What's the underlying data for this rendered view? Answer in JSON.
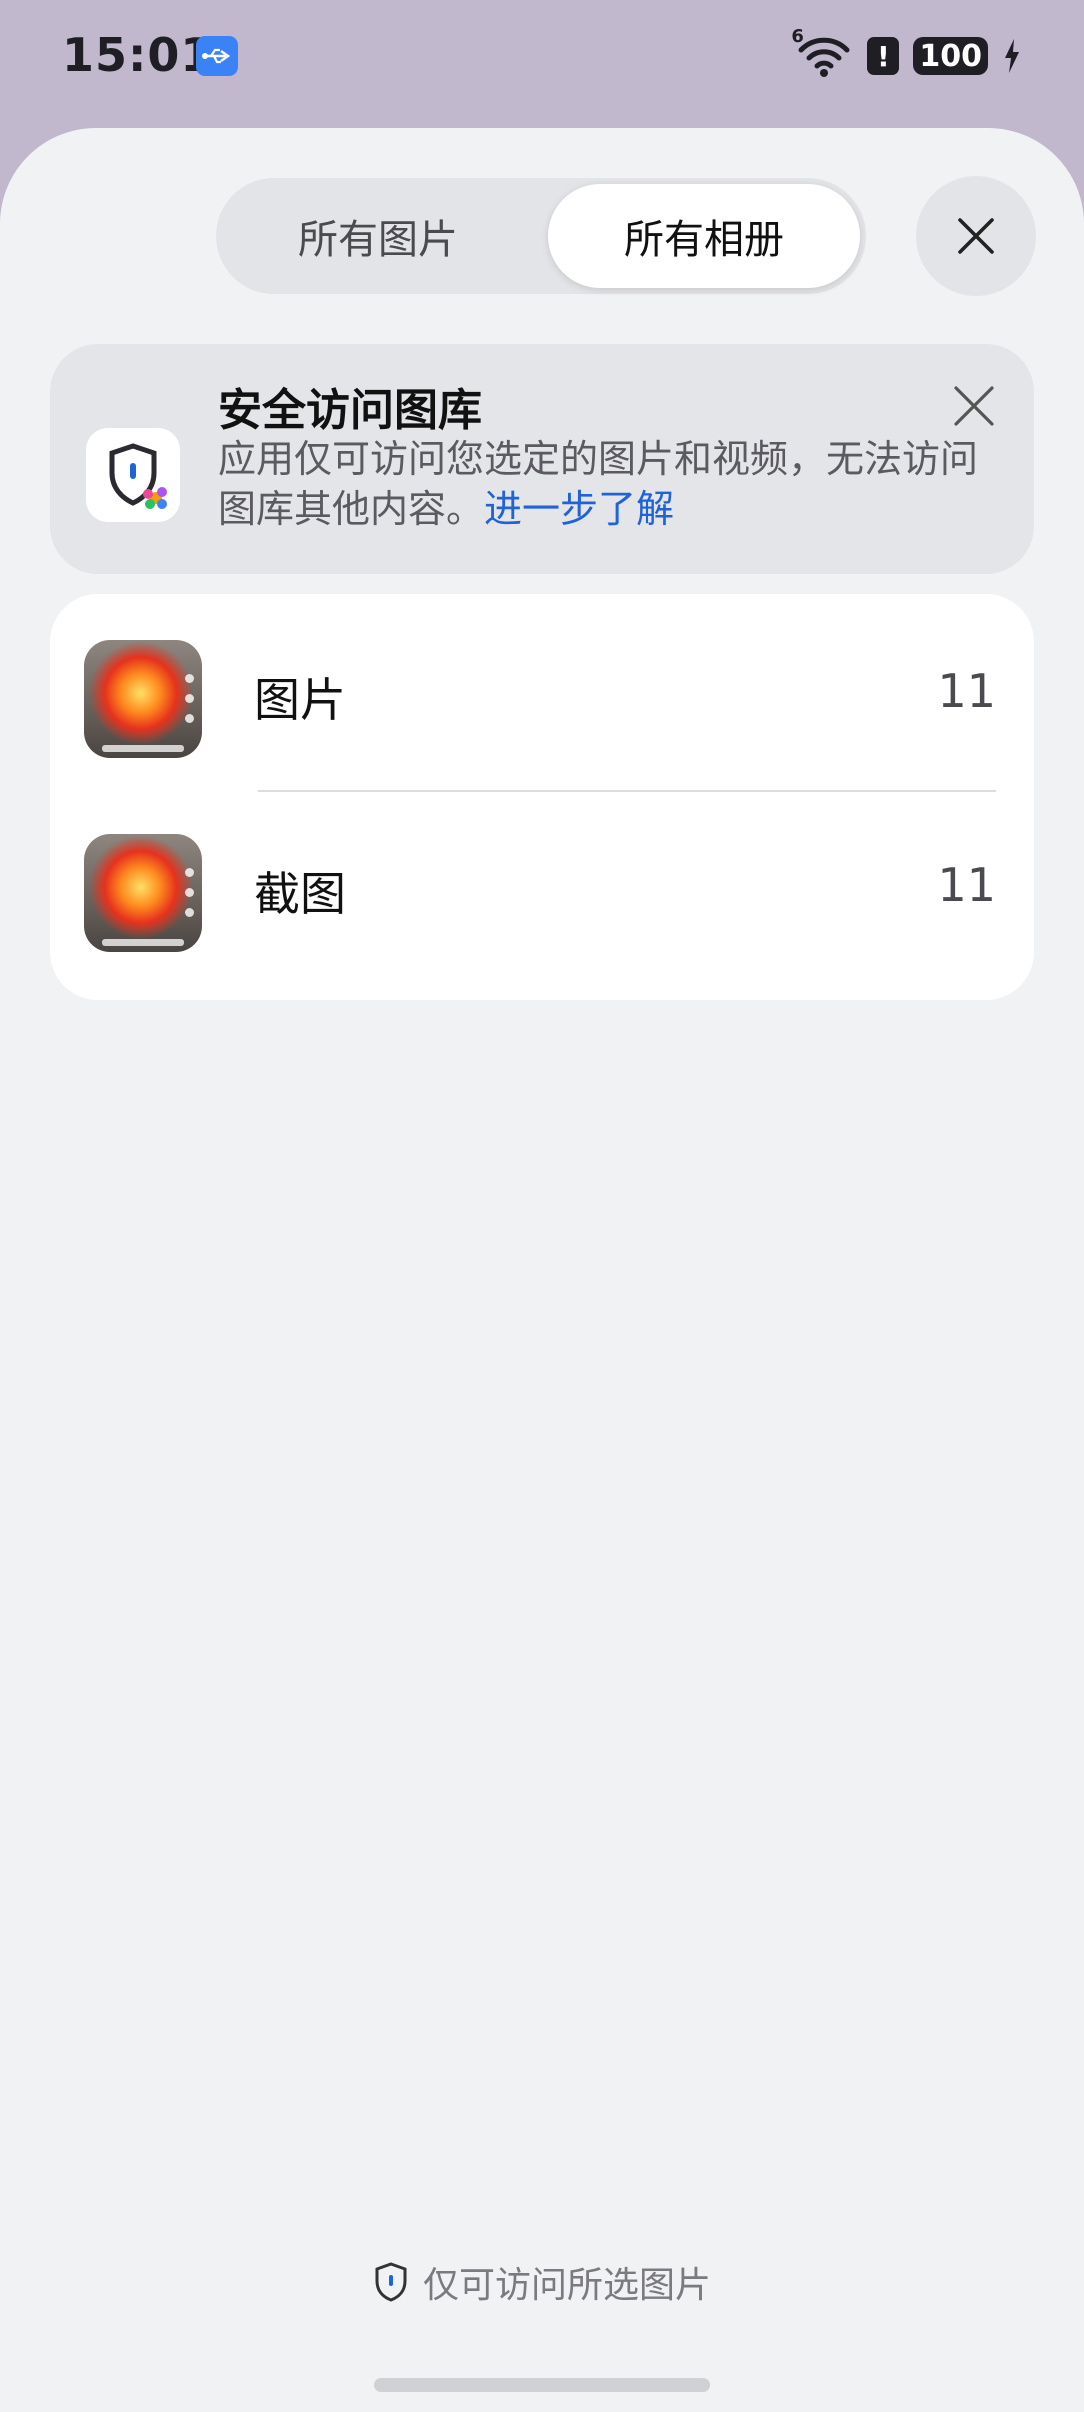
{
  "status_bar": {
    "time": "15:01",
    "signal_label": "6",
    "alert_symbol": "!",
    "battery": "100"
  },
  "tabs": {
    "all_photos": "所有图片",
    "all_albums": "所有相册",
    "selected": "all_albums"
  },
  "banner": {
    "title": "安全访问图库",
    "text": "应用仅可访问您选定的图片和视频，无法访问图库其他内容。",
    "link": "进一步了解"
  },
  "albums": [
    {
      "name": "图片",
      "count": "11"
    },
    {
      "name": "截图",
      "count": "11"
    }
  ],
  "footer": {
    "note": "仅可访问所选图片"
  },
  "colors": {
    "background": "#c1b8ce",
    "sheet": "#f1f2f4",
    "link": "#1f63d6",
    "usb_badge": "#3b82f6"
  },
  "icons": [
    "usb-icon",
    "wifi-icon",
    "alert-icon",
    "battery-icon",
    "charging-icon",
    "close-icon",
    "shield-lock-icon",
    "shield-icon"
  ]
}
